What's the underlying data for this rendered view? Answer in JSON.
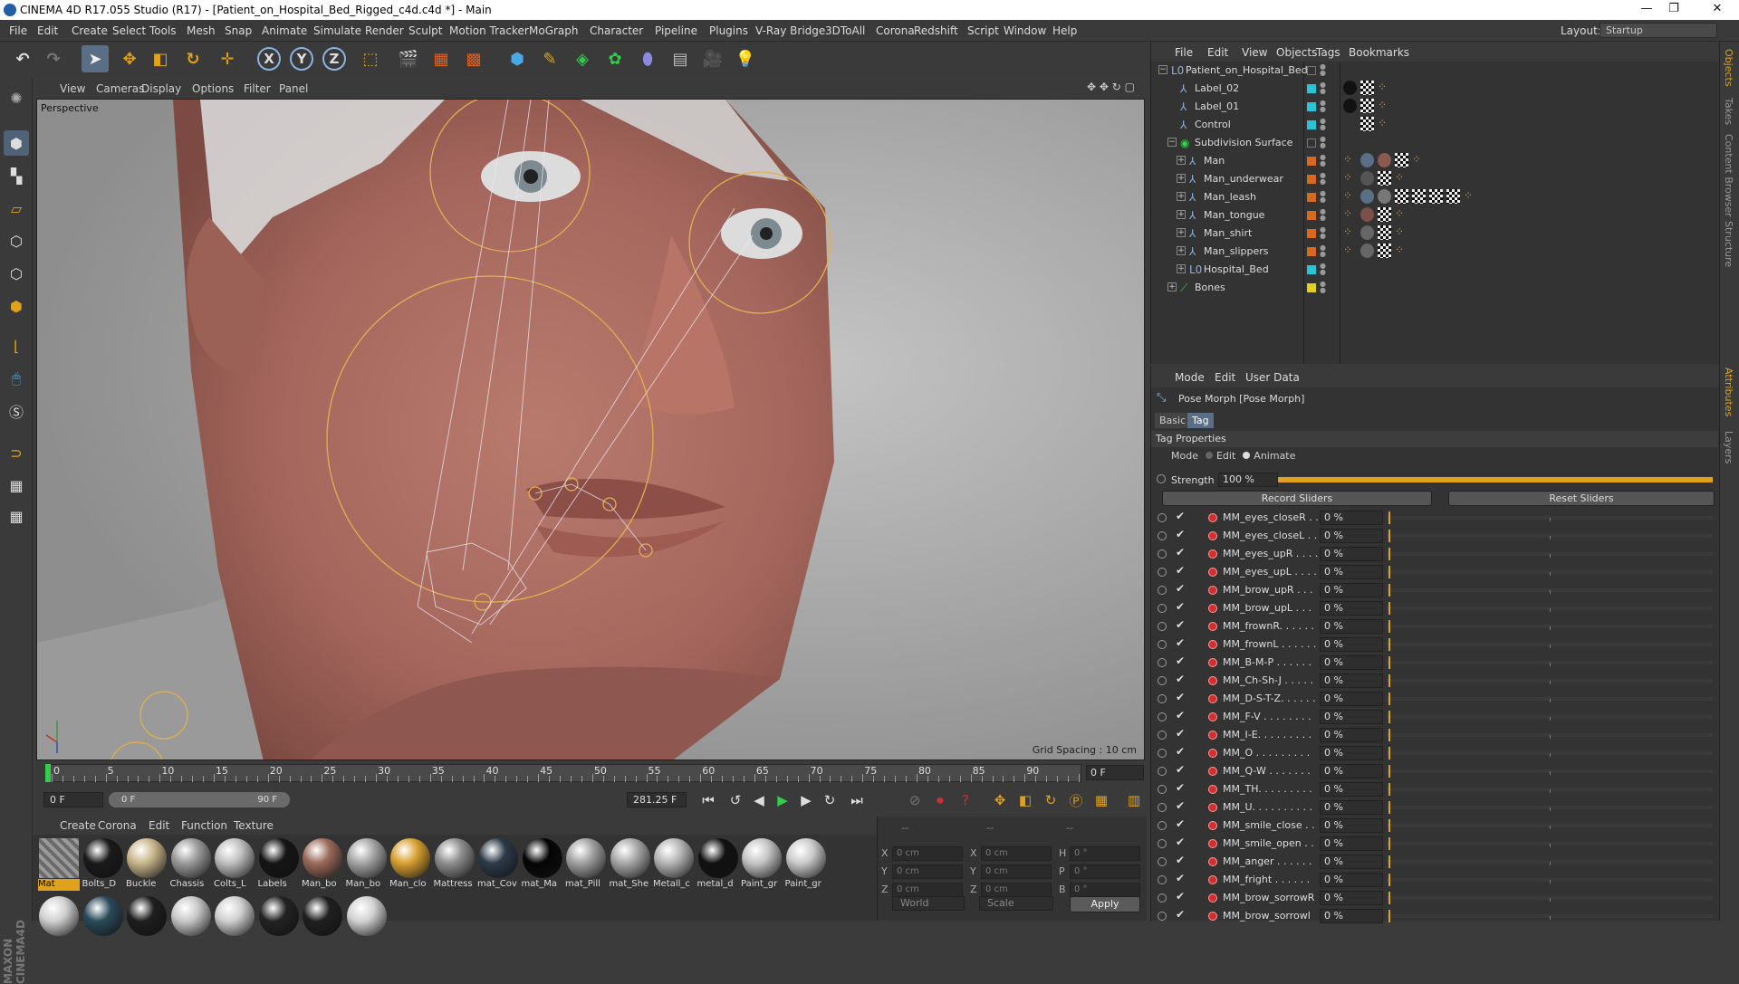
{
  "window": {
    "title": "CINEMA 4D R17.055 Studio (R17) - [Patient_on_Hospital_Bed_Rigged_c4d.c4d *] - Main",
    "min": "—",
    "max": "❐",
    "close": "✕"
  },
  "menu": {
    "items": [
      "File",
      "Edit",
      "Create",
      "Select",
      "Tools",
      "Mesh",
      "Snap",
      "Animate",
      "Simulate",
      "Render",
      "Sculpt",
      "Motion Tracker",
      "MoGraph",
      "Character",
      "Pipeline",
      "Plugins",
      "V-Ray Bridge",
      "3DToAll",
      "Corona",
      "Redshift",
      "Script",
      "Window",
      "Help"
    ],
    "layout_label": "Layout:",
    "layout_value": "Startup"
  },
  "toolbar": {
    "axis": [
      "X",
      "Y",
      "Z"
    ],
    "icons": [
      "undo-icon",
      "redo-icon",
      "select-icon",
      "move-icon",
      "scale-icon",
      "rotate-icon",
      "live-select-icon",
      "x-axis-icon",
      "y-axis-icon",
      "z-axis-icon",
      "world-coord-icon",
      "render-view-icon",
      "render-picture-queue-icon",
      "render-settings-icon",
      "cube-icon",
      "pen-icon",
      "subdivision-icon",
      "cloner-icon",
      "deformer-icon",
      "floor-icon",
      "camera-icon",
      "light-icon"
    ]
  },
  "viewport": {
    "menu": [
      "View",
      "Cameras",
      "Display",
      "Options",
      "Filter",
      "Panel"
    ],
    "label": "Perspective",
    "grid_spacing": "Grid Spacing : 10 cm"
  },
  "timeline": {
    "ticks": [
      "0",
      "5",
      "10",
      "15",
      "20",
      "25",
      "30",
      "35",
      "40",
      "45",
      "50",
      "55",
      "60",
      "65",
      "70",
      "75",
      "80",
      "85",
      "90"
    ],
    "current_frame": "0 F",
    "start_field": "0 F",
    "range_start": "0 F",
    "range_end": "90 F",
    "end_field": "281.25 F"
  },
  "materials": {
    "menu": [
      "Create",
      "Corona",
      "Edit",
      "Function",
      "Texture"
    ],
    "row1": [
      {
        "name": "Mat",
        "color": "#8a8a8a"
      },
      {
        "name": "Bolts_D",
        "color": "#1a1a1a"
      },
      {
        "name": "Buckle",
        "color": "#c8b58a"
      },
      {
        "name": "Chassis",
        "color": "#9a9a9a"
      },
      {
        "name": "Colts_L",
        "color": "#bfbfbf"
      },
      {
        "name": "Labels",
        "color": "#151515"
      },
      {
        "name": "Man_bo",
        "color": "#9a6a5a"
      },
      {
        "name": "Man_bo",
        "color": "#a5a5a5"
      },
      {
        "name": "Man_clo",
        "color": "#d8a030"
      },
      {
        "name": "Mattress",
        "color": "#8e8e8e"
      },
      {
        "name": "mat_Cov",
        "color": "#2c3a48"
      },
      {
        "name": "mat_Ma",
        "color": "#050505"
      },
      {
        "name": "mat_Pill",
        "color": "#a0a0a0"
      },
      {
        "name": "mat_She",
        "color": "#a8a8a8"
      },
      {
        "name": "Metall_c",
        "color": "#b5b5b5"
      },
      {
        "name": "metal_d",
        "color": "#111111"
      },
      {
        "name": "Paint_gr",
        "color": "#c4c4c4"
      },
      {
        "name": "Paint_gr",
        "color": "#cacaca"
      }
    ],
    "row2_colors": [
      "#d0d0d0",
      "#2a4a5a",
      "#1e1e1e",
      "#c8c8c8",
      "#cfcfcf",
      "#222222",
      "#1f1f1f",
      "#d2d2d2"
    ]
  },
  "coords": {
    "headers": [
      "--",
      "--",
      "--"
    ],
    "rows": [
      {
        "a": "X",
        "av": "0 cm",
        "b": "X",
        "bv": "0 cm",
        "c": "H",
        "cv": "0 °"
      },
      {
        "a": "Y",
        "av": "0 cm",
        "b": "Y",
        "bv": "0 cm",
        "c": "P",
        "cv": "0 °"
      },
      {
        "a": "Z",
        "av": "0 cm",
        "b": "Z",
        "bv": "0 cm",
        "c": "B",
        "cv": "0 °"
      }
    ],
    "world": "World",
    "scale": "Scale",
    "apply": "Apply"
  },
  "objects": {
    "menu": [
      "File",
      "Edit",
      "View",
      "Objects",
      "Tags",
      "Bookmarks"
    ],
    "items": [
      {
        "name": "Patient_on_Hospital_Bed",
        "indent": 0,
        "color": "",
        "icon": "L0",
        "expand": "−"
      },
      {
        "name": "Label_02",
        "indent": 1,
        "color": "#29c4d8",
        "icon": "⅄",
        "expand": ""
      },
      {
        "name": "Label_01",
        "indent": 1,
        "color": "#29c4d8",
        "icon": "⅄",
        "expand": ""
      },
      {
        "name": "Control",
        "indent": 1,
        "color": "#29c4d8",
        "icon": "⅄",
        "expand": ""
      },
      {
        "name": "Subdivision Surface",
        "indent": 1,
        "color": "",
        "icon": "◉",
        "expand": "−"
      },
      {
        "name": "Man",
        "indent": 2,
        "color": "#d86a20",
        "icon": "⅄",
        "expand": "+"
      },
      {
        "name": "Man_underwear",
        "indent": 2,
        "color": "#d86a20",
        "icon": "⅄",
        "expand": "+"
      },
      {
        "name": "Man_leash",
        "indent": 2,
        "color": "#d86a20",
        "icon": "⅄",
        "expand": "+"
      },
      {
        "name": "Man_tongue",
        "indent": 2,
        "color": "#d86a20",
        "icon": "⅄",
        "expand": "+"
      },
      {
        "name": "Man_shirt",
        "indent": 2,
        "color": "#d86a20",
        "icon": "⅄",
        "expand": "+"
      },
      {
        "name": "Man_slippers",
        "indent": 2,
        "color": "#d86a20",
        "icon": "⅄",
        "expand": "+"
      },
      {
        "name": "Hospital_Bed",
        "indent": 2,
        "color": "#29c4d8",
        "icon": "L0",
        "expand": "+"
      },
      {
        "name": "Bones",
        "indent": 1,
        "color": "#e0d020",
        "icon": "⟋",
        "expand": "+"
      }
    ]
  },
  "attributes": {
    "menu": [
      "Mode",
      "Edit",
      "User Data"
    ],
    "title": "Pose Morph [Pose Morph]",
    "tabs": [
      "Basic",
      "Tag"
    ],
    "section": "Tag Properties",
    "mode_label": "Mode",
    "mode_edit": "Edit",
    "mode_animate": "Animate",
    "strength_label": "Strength",
    "strength_value": "100 %",
    "strength": 1.0,
    "record": "Record Sliders",
    "reset": "Reset Sliders",
    "sliders": [
      {
        "name": "MM_eyes_closeR . .",
        "value": "0 %"
      },
      {
        "name": "MM_eyes_closeL . .",
        "value": "0 %"
      },
      {
        "name": "MM_eyes_upR . . . .",
        "value": "0 %"
      },
      {
        "name": "MM_eyes_upL . . . .",
        "value": "0 %"
      },
      {
        "name": "MM_brow_upR . . .",
        "value": "0 %"
      },
      {
        "name": "MM_brow_upL . . .",
        "value": "0 %"
      },
      {
        "name": "MM_frownR. . . . . .",
        "value": "0 %"
      },
      {
        "name": "MM_frownL . . . . . .",
        "value": "0 %"
      },
      {
        "name": "MM_B-M-P . . . . . .",
        "value": "0 %"
      },
      {
        "name": "MM_Ch-Sh-J . . . . .",
        "value": "0 %"
      },
      {
        "name": "MM_D-S-T-Z. . . . . .",
        "value": "0 %"
      },
      {
        "name": "MM_F-V . . . . . . . .",
        "value": "0 %"
      },
      {
        "name": "MM_I-E. . . . . . . . .",
        "value": "0 %"
      },
      {
        "name": "MM_O . . . . . . . . .",
        "value": "0 %"
      },
      {
        "name": "MM_Q-W . . . . . . .",
        "value": "0 %"
      },
      {
        "name": "MM_TH. . . . . . . . .",
        "value": "0 %"
      },
      {
        "name": "MM_U. . . . . . . . . .",
        "value": "0 %"
      },
      {
        "name": "MM_smile_close . .",
        "value": "0 %"
      },
      {
        "name": "MM_smile_open . .",
        "value": "0 %"
      },
      {
        "name": "MM_anger . . . . . .",
        "value": "0 %"
      },
      {
        "name": "MM_fright . . . . . .",
        "value": "0 %"
      },
      {
        "name": "MM_brow_sorrowR",
        "value": "0 %"
      },
      {
        "name": "MM_brow_sorrowl",
        "value": "0 %"
      }
    ]
  },
  "side_tabs": [
    "Objects",
    "Takes",
    "Content Browser",
    "Structure",
    "Attributes",
    "Layers"
  ]
}
